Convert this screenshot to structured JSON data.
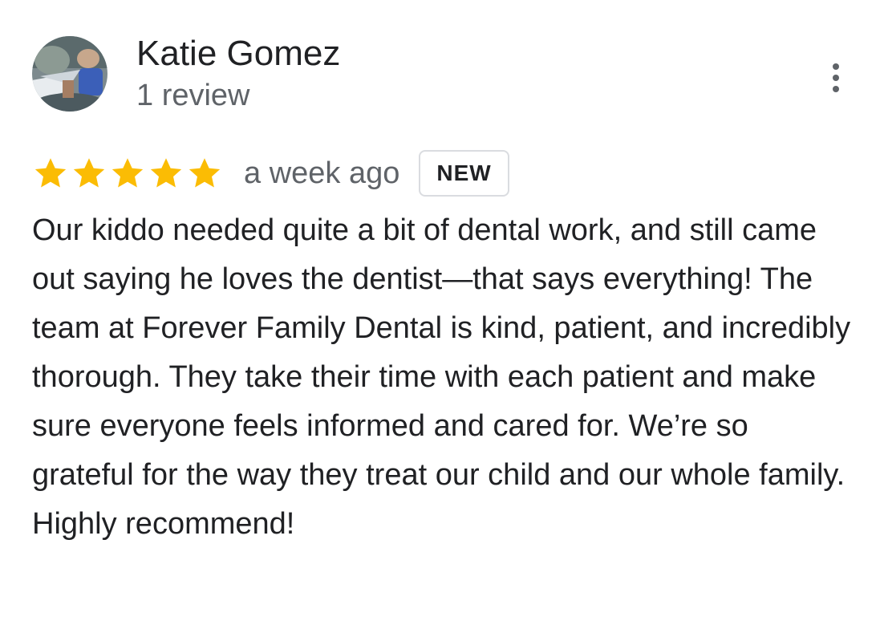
{
  "reviewer": {
    "name": "Katie Gomez",
    "review_count": "1 review",
    "avatar_icon": "profile-photo"
  },
  "menu": {
    "icon": "more-vert-icon"
  },
  "review": {
    "rating": 5,
    "rating_max": 5,
    "star_color": "#FBBC04",
    "time": "a week ago",
    "badge": "NEW",
    "text": "Our kiddo needed quite a bit of dental work, and still came out saying he loves the dentist—that says everything! The team at Forever Family Dental is kind, patient, and incredibly thorough. They take their time with each patient and make sure everyone feels informed and cared for. We’re so grateful for the way they treat our child and our whole family. Highly recommend!"
  }
}
